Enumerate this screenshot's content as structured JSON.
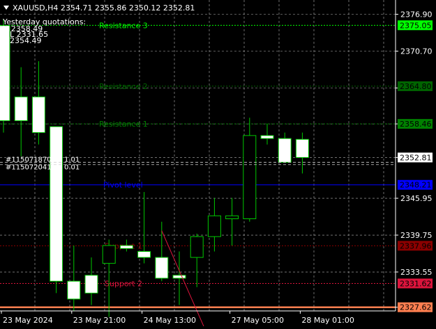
{
  "header": {
    "symbol_line": "XAUUSD,H4  2354.71 2355.86 2350.12 2352.81",
    "yesterday_title": "Yesterday quotations:",
    "yesterday_high": "H 2358.49",
    "yesterday_low": "L 2331.65",
    "yesterday_close": "2354.49"
  },
  "order_labels": [
    "#115071870",
    "#115072041"
  ],
  "order_values": [
    "1.01",
    "0.01"
  ],
  "colors": {
    "background": "#000000",
    "bull_candle": "#ffffff",
    "bear_candle": "#ffffff",
    "wick": "#00c800",
    "grid": "#b4b4b4",
    "price_tag": "#ffffff",
    "pivot": "#0000ff",
    "resistance_3": "#00ff00",
    "resistance_2": "#006400",
    "resistance_1": "#008000",
    "support_1": "#8b0000",
    "support_2": "#dc143c",
    "support_3": "#ff7f50"
  },
  "chart_data": {
    "type": "candlestick",
    "symbol": "XAUUSD",
    "timeframe": "H4",
    "ylim": [
      2327.0,
      2379.3
    ],
    "y_ticks": [
      "2376.90",
      "2370.70",
      "2364.50",
      "2358.46",
      "2352.81",
      "2345.95",
      "2339.75",
      "2333.55",
      "2327.62"
    ],
    "y_ticks_values": [
      2376.9,
      2370.7,
      2364.5,
      2358.46,
      2352.81,
      2345.95,
      2339.75,
      2333.55,
      2327.62
    ],
    "x_tick_labels": [
      "23 May 2024",
      "23 May 21:00",
      "24 May 13:00",
      "27 May 05:00",
      "28 May 01:00"
    ],
    "x_tick_candle_index": [
      0,
      4,
      8,
      13,
      17
    ],
    "candles": [
      {
        "o": 2375.0,
        "h": 2376.0,
        "l": 2357.0,
        "c": 2359.0
      },
      {
        "o": 2363.0,
        "h": 2368.0,
        "l": 2353.0,
        "c": 2359.0
      },
      {
        "o": 2363.0,
        "h": 2369.0,
        "l": 2355.0,
        "c": 2357.0
      },
      {
        "o": 2358.0,
        "h": 2358.0,
        "l": 2330.0,
        "c": 2332.0
      },
      {
        "o": 2332.0,
        "h": 2338.0,
        "l": 2327.0,
        "c": 2329.0
      },
      {
        "o": 2333.0,
        "h": 2336.0,
        "l": 2328.0,
        "c": 2330.0
      },
      {
        "o": 2335.0,
        "h": 2339.0,
        "l": 2326.0,
        "c": 2338.0
      },
      {
        "o": 2338.0,
        "h": 2339.0,
        "l": 2337.0,
        "c": 2337.5
      },
      {
        "o": 2337.0,
        "h": 2347.0,
        "l": 2335.0,
        "c": 2336.0
      },
      {
        "o": 2336.0,
        "h": 2342.0,
        "l": 2332.0,
        "c": 2332.5
      },
      {
        "o": 2333.0,
        "h": 2337.0,
        "l": 2328.0,
        "c": 2332.5
      },
      {
        "o": 2336.0,
        "h": 2340.0,
        "l": 2331.0,
        "c": 2339.5
      },
      {
        "o": 2339.5,
        "h": 2346.0,
        "l": 2337.0,
        "c": 2343.0
      },
      {
        "o": 2342.5,
        "h": 2346.0,
        "l": 2338.0,
        "c": 2343.0
      },
      {
        "o": 2342.5,
        "h": 2359.5,
        "l": 2342.0,
        "c": 2356.5
      },
      {
        "o": 2356.5,
        "h": 2358.5,
        "l": 2355.0,
        "c": 2356.0
      },
      {
        "o": 2356.0,
        "h": 2357.0,
        "l": 2352.0,
        "c": 2352.0
      },
      {
        "o": 2355.86,
        "h": 2357.0,
        "l": 2350.12,
        "c": 2352.81
      }
    ],
    "current_price": 2352.81,
    "levels": [
      {
        "label": "Resistance 3",
        "price": 2375.05,
        "price_label": "2375.05",
        "color": "#00ff00",
        "tag_text": "#000000"
      },
      {
        "label": "Resistance 2",
        "price": 2364.8,
        "price_label": "2364.80",
        "color": "#006400",
        "tag_text": "#000000"
      },
      {
        "label": "Resistance 1",
        "price": 2358.46,
        "price_label": "2358.46",
        "color": "#008000",
        "tag_text": "#000000"
      },
      {
        "label": "Pivot level",
        "price": 2348.21,
        "price_label": "2348.21",
        "color": "#0000ff",
        "tag_text": "#000000"
      },
      {
        "label": "Support 1",
        "price": 2337.96,
        "price_label": "2337.96",
        "color": "#8b0000",
        "tag_text": "#000000"
      },
      {
        "label": "Support 2",
        "price": 2331.62,
        "price_label": "2331.62",
        "color": "#dc143c",
        "tag_text": "#000000"
      },
      {
        "label": "",
        "price": 2327.62,
        "price_label": "2327.62",
        "color": "#ff7f50",
        "tag_text": "#000000"
      }
    ],
    "order_prices": [
      2352.0,
      2351.6
    ],
    "trendline": {
      "from": {
        "candle": 9,
        "price": 2340.5
      },
      "to": {
        "candle": 11.6,
        "price": 2323.0
      }
    }
  }
}
